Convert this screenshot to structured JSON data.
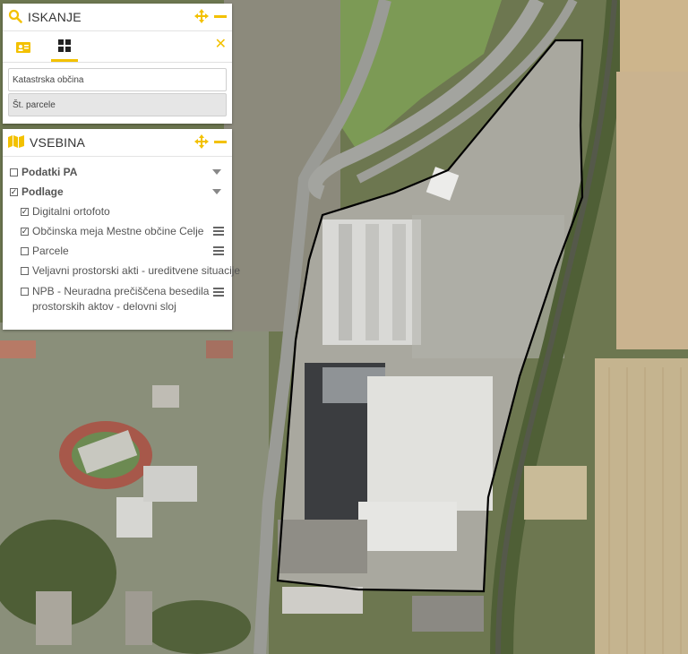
{
  "search": {
    "title": "ISKANJE",
    "field_cadastral_placeholder": "Katastrska občina",
    "field_parcels_placeholder": "Št. parcele"
  },
  "content": {
    "title": "VSEBINA",
    "groups": [
      {
        "label": "Podatki PA",
        "checked": false
      },
      {
        "label": "Podlage",
        "checked": true
      }
    ],
    "layers": [
      {
        "label": "Digitalni ortofoto",
        "checked": true
      },
      {
        "label": "Občinska meja Mestne občine Celje",
        "checked": true
      },
      {
        "label": "Parcele",
        "checked": false
      },
      {
        "label": "Veljavni prostorski akti - ureditvene situacije",
        "checked": false
      },
      {
        "label": "NPB - Neuradna prečiščena besedila prostorskih aktov - delovni sloj",
        "checked": false
      }
    ]
  },
  "colors": {
    "accent": "#f3c100",
    "boundary": "#000000"
  },
  "icons": [
    "search-icon",
    "move-icon",
    "minimize-icon",
    "id-card-icon",
    "grid-icon",
    "close-icon",
    "map-icon",
    "chevron-down-icon",
    "menu-icon"
  ]
}
